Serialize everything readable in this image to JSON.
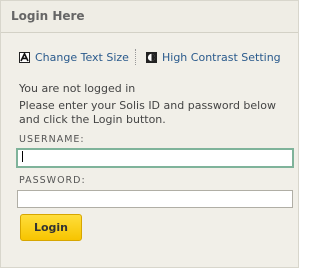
{
  "header": {
    "title": "Login Here"
  },
  "tools": {
    "change_text_size": {
      "label": "Change Text Size",
      "icon": "text-size-icon"
    },
    "high_contrast": {
      "label": "High Contrast Setting",
      "icon": "contrast-icon"
    }
  },
  "message": {
    "status": "You are not logged in",
    "instructions": "Please enter your Solis ID and password below and click the Login button."
  },
  "form": {
    "username_label": "USERNAME:",
    "username_value": "",
    "password_label": "PASSWORD:",
    "password_value": "",
    "login_label": "Login"
  },
  "colors": {
    "link": "#2a5a8c",
    "panel_bg": "#f1efe8",
    "button": "#f9cf14",
    "focus_border": "#7fb39a"
  }
}
